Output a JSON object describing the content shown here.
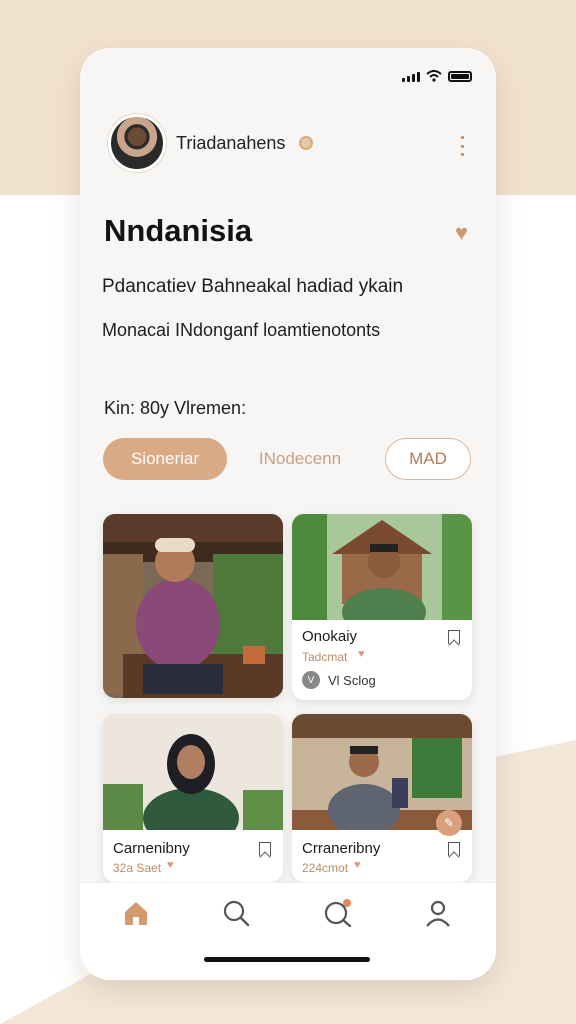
{
  "profile": {
    "name": "Triadanahens"
  },
  "header": {
    "title": "Nndanisia"
  },
  "text": {
    "line1": "Pdancatiev Bahneakal hadiad ykain",
    "line2": "Monacai INdonganf loamtienotonts"
  },
  "section_label": "Kin: 80y Vlremen:",
  "chips": [
    {
      "label": "Sioneriar",
      "active": true
    },
    {
      "label": "INodecenn",
      "active": false
    },
    {
      "label": "MAD",
      "active": false
    }
  ],
  "cards": [
    {
      "name": "Onokaiy",
      "subtitle": "Tadcmat",
      "visibility": "Vl Sclog"
    },
    {
      "name": "Carnenibny",
      "subtitle": "32a Saet"
    },
    {
      "name": "Crraneribny",
      "subtitle": "224cmot"
    }
  ],
  "nav": [
    "home-icon",
    "search-icon",
    "explore-icon",
    "profile-icon"
  ],
  "colors": {
    "accent": "#d9aa84",
    "accent_dark": "#b57c55"
  }
}
